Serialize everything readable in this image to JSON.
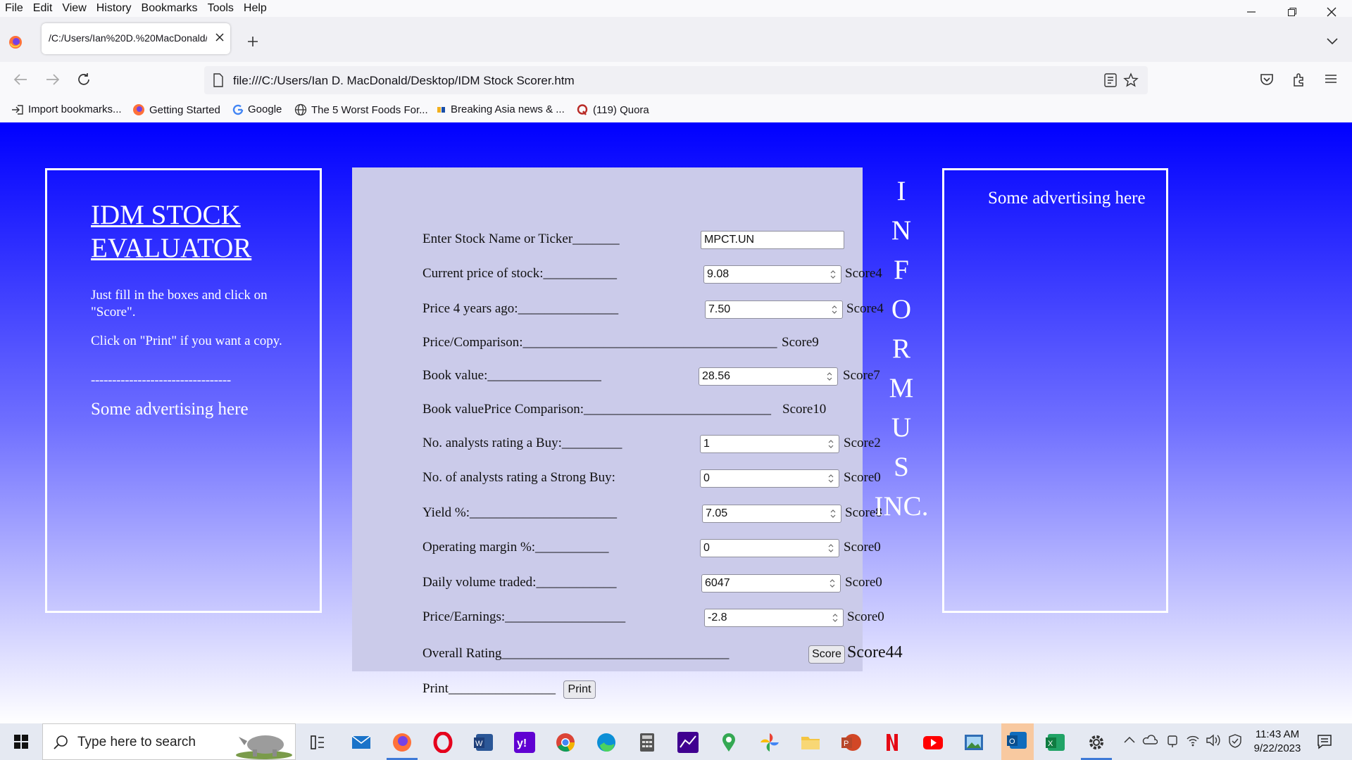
{
  "menubar": {
    "items": [
      "File",
      "Edit",
      "View",
      "History",
      "Bookmarks",
      "Tools",
      "Help"
    ]
  },
  "tab": {
    "title": "/C:/Users/Ian%20D.%20MacDonald/"
  },
  "url": "file:///C:/Users/Ian D. MacDonald/Desktop/IDM Stock Scorer.htm",
  "bookmarks": [
    "Import bookmarks...",
    "Getting Started",
    "Google",
    "The 5 Worst Foods For...",
    "Breaking Asia news & ...",
    "(119) Quora"
  ],
  "left_panel": {
    "title": "IDM STOCK EVALUATOR",
    "instructions": "Just fill in the boxes and click on \"Score\".",
    "print_note": "Click on \"Print\" if you want a copy.",
    "divider": "---------------------------------",
    "ad": "Some advertising here"
  },
  "right_panel": {
    "ad": "Some advertising here"
  },
  "brand_letters": [
    "I",
    "N",
    "F",
    "O",
    "R",
    "M",
    "U",
    "S",
    "INC."
  ],
  "form": {
    "rows": [
      {
        "label": "Enter Stock Name or Ticker_______",
        "value": "MPCT.UN",
        "score": ""
      },
      {
        "label": "Current price of stock:___________",
        "value": "9.08",
        "score": "Score4"
      },
      {
        "label": "Price 4 years ago:_______________",
        "value": "7.50",
        "score": "Score4"
      },
      {
        "label": "Price/Comparison:______________________________________",
        "value": "",
        "score": "Score9"
      },
      {
        "label": "Book value:_________________",
        "value": "28.56",
        "score": "Score7"
      },
      {
        "label": "Book valuePrice Comparison:____________________________",
        "value": "",
        "score": "Score10"
      },
      {
        "label": "No. analysts rating a Buy:_________",
        "value": "1",
        "score": "Score2"
      },
      {
        "label": "No. of analysts rating a Strong Buy:",
        "value": "0",
        "score": "Score0"
      },
      {
        "label": "Yield %:______________________",
        "value": "7.05",
        "score": "Score8"
      },
      {
        "label": "Operating margin %:___________",
        "value": "0",
        "score": "Score0"
      },
      {
        "label": "Daily volume traded:____________",
        "value": "6047",
        "score": "Score0"
      },
      {
        "label": "Price/Earnings:__________________",
        "value": "-2.8",
        "score": "Score0"
      }
    ],
    "overall_label": "Overall Rating__________________________________",
    "score_button": "Score",
    "overall_score": "Score44",
    "print_label": "Print________________",
    "print_button": "Print"
  },
  "taskbar": {
    "search_placeholder": "Type here to search",
    "time": "11:43 AM",
    "date": "9/22/2023"
  },
  "colors": {
    "page_top": "#0000ff",
    "page_bottom": "#ffffff",
    "form_panel": "#cbcbea"
  }
}
